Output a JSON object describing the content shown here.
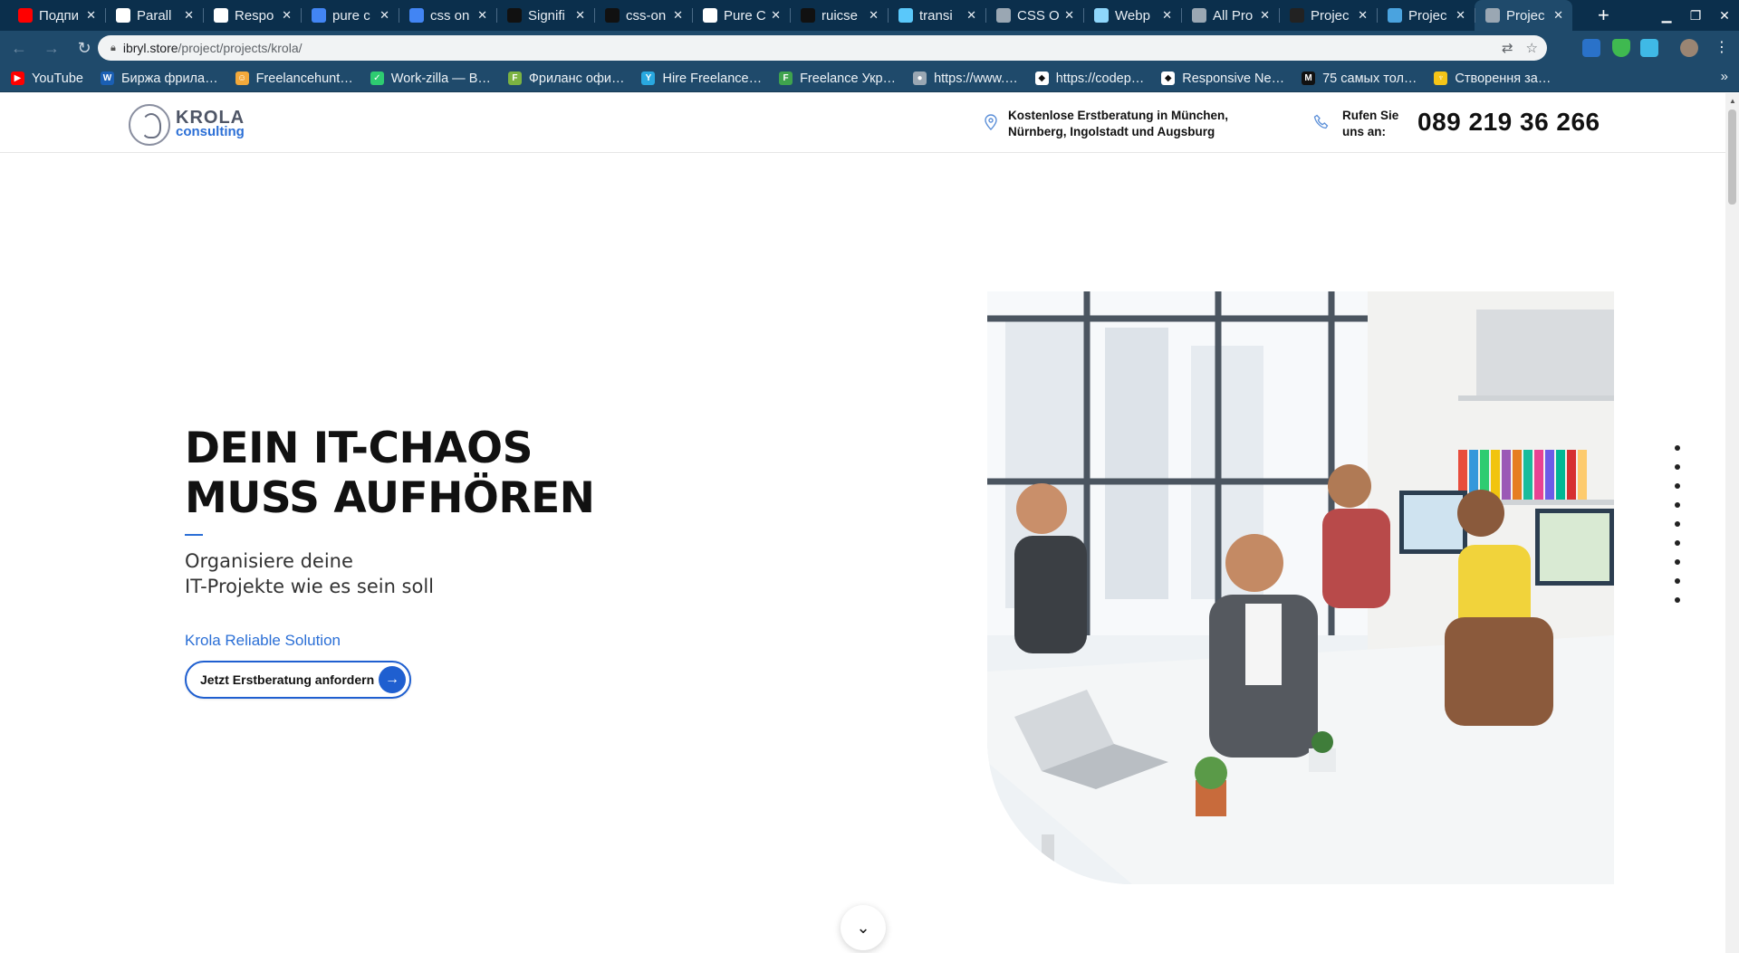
{
  "browser": {
    "tabs": [
      {
        "title": "Подпи",
        "icon": "youtube-icon",
        "color": "#ff0000"
      },
      {
        "title": "Parall",
        "icon": "codepen-icon",
        "color": "#ffffff"
      },
      {
        "title": "Respo",
        "icon": "codepen-icon",
        "color": "#ffffff"
      },
      {
        "title": "pure c",
        "icon": "google-icon",
        "color": "#4285f4"
      },
      {
        "title": "css on",
        "icon": "google-icon",
        "color": "#4285f4"
      },
      {
        "title": "Signifi",
        "icon": "github-icon",
        "color": "#111111"
      },
      {
        "title": "css-on",
        "icon": "github-icon",
        "color": "#111111"
      },
      {
        "title": "Pure C",
        "icon": "codepen-icon",
        "color": "#ffffff"
      },
      {
        "title": "ruicse",
        "icon": "github-icon",
        "color": "#111111"
      },
      {
        "title": "transi",
        "icon": "page-icon",
        "color": "#5ac8fa"
      },
      {
        "title": "CSS O",
        "icon": "globe-icon",
        "color": "#9aa7b3"
      },
      {
        "title": "Webp",
        "icon": "webpack-icon",
        "color": "#8ed6fb"
      },
      {
        "title": "All Pro",
        "icon": "globe-icon",
        "color": "#9aa7b3"
      },
      {
        "title": "Projec",
        "icon": "bird-icon",
        "color": "#222222"
      },
      {
        "title": "Projec",
        "icon": "image-icon",
        "color": "#4aa3df"
      },
      {
        "title": "Projec",
        "icon": "globe-icon",
        "color": "#9aa7b3"
      }
    ],
    "active_tab_index": 15,
    "new_tab": "+",
    "url_host": "ibryl.store",
    "url_path": "/project/projects/krola/",
    "bookmarks": [
      {
        "label": "YouTube",
        "color": "#ff0000",
        "glyph": "▶"
      },
      {
        "label": "Биржа фрила…",
        "color": "#1a5fb4",
        "glyph": "W"
      },
      {
        "label": "Freelancehunt…",
        "color": "#f2a93b",
        "glyph": "☺"
      },
      {
        "label": "Work-zilla — В…",
        "color": "#2ecc71",
        "glyph": "✓"
      },
      {
        "label": "Фриланс офи…",
        "color": "#7cb342",
        "glyph": "F"
      },
      {
        "label": "Hire Freelance…",
        "color": "#29a8e0",
        "glyph": "Y"
      },
      {
        "label": "Freelance Укр…",
        "color": "#3fa34d",
        "glyph": "F"
      },
      {
        "label": "https://www.…",
        "color": "#9aa7b3",
        "glyph": "●"
      },
      {
        "label": "https://codep…",
        "color": "#ffffff",
        "glyph": "◆"
      },
      {
        "label": "Responsive Ne…",
        "color": "#ffffff",
        "glyph": "◆"
      },
      {
        "label": "75 самых тол…",
        "color": "#111111",
        "glyph": "M"
      },
      {
        "label": "Створення за…",
        "color": "#f5c518",
        "glyph": "♆"
      }
    ],
    "bookmarks_more": "»"
  },
  "header": {
    "logo_line1": "KROLA",
    "logo_line2": "consulting",
    "location_text": "Kostenlose Erstberatung in München, Nürnberg, Ingolstadt und Augsburg",
    "call_label": "Rufen Sie uns an:",
    "phone": "089 219 36 266"
  },
  "hero": {
    "title_line1": "DEIN IT-CHAOS",
    "title_line2": "MUSS AUFHÖREN",
    "subtitle_line1": "Organisiere deine",
    "subtitle_line2": "IT-Projekte wie es sein soll",
    "brand": "Krola Reliable Solution",
    "cta_label": "Jetzt Erstberatung anfordern",
    "accent_color": "#2b6fd6"
  },
  "pagination_dots": 9
}
